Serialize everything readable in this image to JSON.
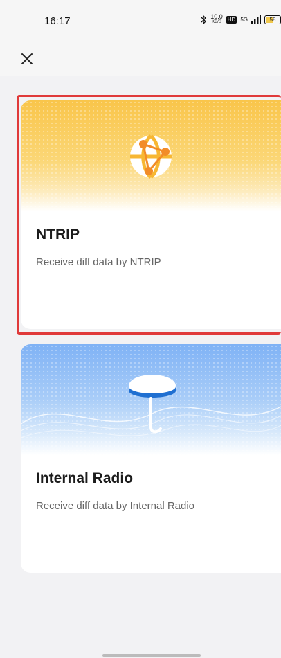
{
  "status": {
    "time": "16:17",
    "speed_value": "10.0",
    "speed_unit": "KB/S",
    "hd": "HD",
    "network": "5G",
    "battery": "58"
  },
  "cards": [
    {
      "title": "NTRIP",
      "description": "Receive diff data by NTRIP",
      "selected": true
    },
    {
      "title": "Internal Radio",
      "description": "Receive diff data by Internal Radio",
      "selected": false
    }
  ],
  "colors": {
    "selection": "#e03a3a",
    "ntrip_banner": "#f9c54a",
    "radio_banner": "#7fb2f5"
  },
  "icons": [
    "close-icon",
    "globe-network-icon",
    "antenna-icon",
    "bluetooth-icon",
    "signal-icon",
    "battery-icon"
  ]
}
